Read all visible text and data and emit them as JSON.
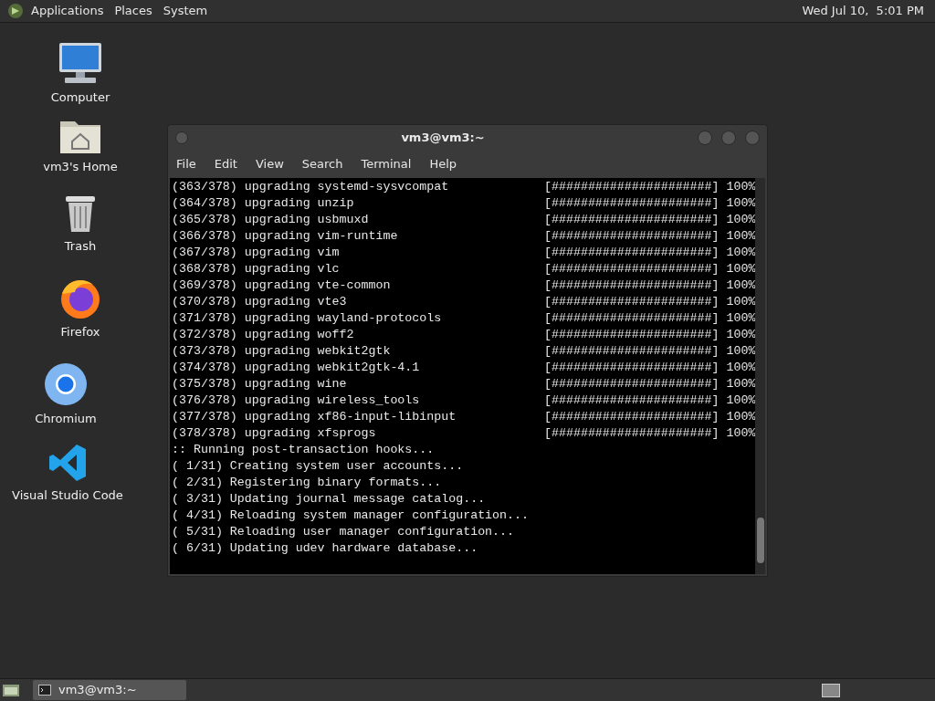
{
  "top_panel": {
    "menus": [
      "Applications",
      "Places",
      "System"
    ],
    "clock": "Wed Jul 10,  5:01 PM"
  },
  "desktop_icons": [
    {
      "kind": "computer",
      "label": "Computer"
    },
    {
      "kind": "home",
      "label": "vm3's Home"
    },
    {
      "kind": "trash",
      "label": "Trash"
    },
    {
      "kind": "firefox",
      "label": "Firefox"
    },
    {
      "kind": "chromium",
      "label": "Chromium"
    },
    {
      "kind": "vscode",
      "label": "Visual Studio Code"
    }
  ],
  "window": {
    "title": "vm3@vm3:~",
    "menus": [
      "File",
      "Edit",
      "View",
      "Search",
      "Terminal",
      "Help"
    ],
    "lines": [
      {
        "text": "(363/378) upgrading systemd-sysvcompat",
        "progress": "[######################]",
        "percent": "100%"
      },
      {
        "text": "(364/378) upgrading unzip",
        "progress": "[######################]",
        "percent": "100%"
      },
      {
        "text": "(365/378) upgrading usbmuxd",
        "progress": "[######################]",
        "percent": "100%"
      },
      {
        "text": "(366/378) upgrading vim-runtime",
        "progress": "[######################]",
        "percent": "100%"
      },
      {
        "text": "(367/378) upgrading vim",
        "progress": "[######################]",
        "percent": "100%"
      },
      {
        "text": "(368/378) upgrading vlc",
        "progress": "[######################]",
        "percent": "100%"
      },
      {
        "text": "(369/378) upgrading vte-common",
        "progress": "[######################]",
        "percent": "100%"
      },
      {
        "text": "(370/378) upgrading vte3",
        "progress": "[######################]",
        "percent": "100%"
      },
      {
        "text": "(371/378) upgrading wayland-protocols",
        "progress": "[######################]",
        "percent": "100%"
      },
      {
        "text": "(372/378) upgrading woff2",
        "progress": "[######################]",
        "percent": "100%"
      },
      {
        "text": "(373/378) upgrading webkit2gtk",
        "progress": "[######################]",
        "percent": "100%"
      },
      {
        "text": "(374/378) upgrading webkit2gtk-4.1",
        "progress": "[######################]",
        "percent": "100%"
      },
      {
        "text": "(375/378) upgrading wine",
        "progress": "[######################]",
        "percent": "100%"
      },
      {
        "text": "(376/378) upgrading wireless_tools",
        "progress": "[######################]",
        "percent": "100%"
      },
      {
        "text": "(377/378) upgrading xf86-input-libinput",
        "progress": "[######################]",
        "percent": "100%"
      },
      {
        "text": "(378/378) upgrading xfsprogs",
        "progress": "[######################]",
        "percent": "100%"
      },
      {
        "text": ":: Running post-transaction hooks..."
      },
      {
        "text": "( 1/31) Creating system user accounts..."
      },
      {
        "text": "( 2/31) Registering binary formats..."
      },
      {
        "text": "( 3/31) Updating journal message catalog..."
      },
      {
        "text": "( 4/31) Reloading system manager configuration..."
      },
      {
        "text": "( 5/31) Reloading user manager configuration..."
      },
      {
        "text": "( 6/31) Updating udev hardware database..."
      }
    ]
  },
  "taskbar": {
    "tasks": [
      {
        "label": "vm3@vm3:~",
        "selected": true
      }
    ]
  }
}
